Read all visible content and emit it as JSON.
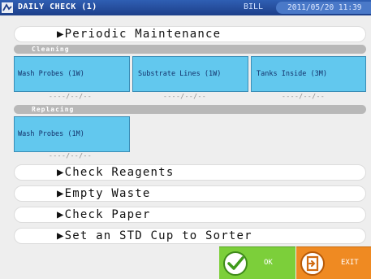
{
  "header": {
    "title": "DAILY CHECK (1)",
    "user": "BILL",
    "datetime": "2011/05/20 11:39"
  },
  "periodic": {
    "label": "Periodic Maintenance"
  },
  "cleaning": {
    "section_label": "Cleaning",
    "items": [
      {
        "label": "Wash Probes (1W)",
        "date": "----/--/--"
      },
      {
        "label": "Substrate Lines (1W)",
        "date": "----/--/--"
      },
      {
        "label": "Tanks Inside (3M)",
        "date": "----/--/--"
      }
    ]
  },
  "replacing": {
    "section_label": "Replacing",
    "items": [
      {
        "label": "Wash Probes (1M)",
        "date": "----/--/--"
      }
    ]
  },
  "actions": [
    {
      "label": "Check Reagents"
    },
    {
      "label": "Empty Waste"
    },
    {
      "label": "Check Paper"
    },
    {
      "label": "Set an STD Cup to Sorter"
    }
  ],
  "footer": {
    "ok_label": "OK",
    "exit_label": "EXIT"
  },
  "colors": {
    "titlebar": "#2f5fb3",
    "tile": "#62c8ee",
    "ok": "#7ccf3a",
    "exit": "#ef8a22"
  },
  "icons": {
    "app": "device-logo-icon",
    "ok": "check-circle-icon",
    "exit": "exit-door-icon",
    "pill": "triangle-right-icon"
  }
}
